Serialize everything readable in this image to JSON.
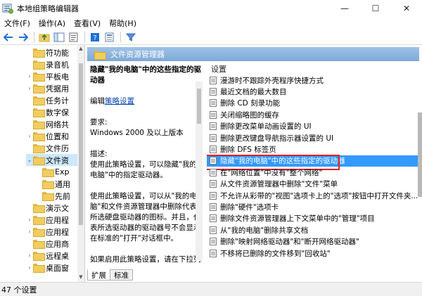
{
  "window": {
    "title": "本地组策略编辑器",
    "minimize": "—",
    "maximize": "☐",
    "close": "✕"
  },
  "menu": [
    "文件(F)",
    "操作(A)",
    "查看(V)",
    "帮助(H)"
  ],
  "toolbar": {
    "icons": [
      "back-icon",
      "forward-icon",
      "up-folder-icon",
      "show-hide-tree-icon",
      "export-list-icon",
      "help-icon",
      "properties-icon",
      "filter-icon"
    ]
  },
  "tree": {
    "items": [
      {
        "label": "符功能",
        "expander": ""
      },
      {
        "label": "录音机",
        "expander": ""
      },
      {
        "label": "平板电",
        "expander": "›"
      },
      {
        "label": "凭据用",
        "expander": "›"
      },
      {
        "label": "任务计",
        "expander": ""
      },
      {
        "label": "数字保",
        "expander": ""
      },
      {
        "label": "网络共",
        "expander": ""
      },
      {
        "label": "位置和",
        "expander": "›"
      },
      {
        "label": "文件历",
        "expander": ""
      },
      {
        "label": "文件资",
        "expander": "⌄"
      },
      {
        "label": "Exp",
        "expander": ""
      },
      {
        "label": "通用",
        "expander": ""
      },
      {
        "label": "先前",
        "expander": ""
      },
      {
        "label": "演示文",
        "expander": ""
      },
      {
        "label": "应用程",
        "expander": "›"
      },
      {
        "label": "应用程",
        "expander": "›"
      },
      {
        "label": "应用商",
        "expander": ""
      },
      {
        "label": "远程桌",
        "expander": "›"
      },
      {
        "label": "桌面窗",
        "expander": "›"
      }
    ]
  },
  "pane_header": "文件资源管理器",
  "description": {
    "title": "隐藏\"我的电脑\"中的这些指定的驱动器",
    "edit_prefix": "编辑",
    "edit_link": "策略设置",
    "requirements_label": "要求:",
    "requirements_value": "Windows 2000 及以上版本",
    "desc_label": "描述:",
    "paragraph1": "使用此策略设置，可以隐藏\"我的电脑\"中的指定驱动器。",
    "paragraph2": "使用此策略设置，可以从\"我的电脑\"和文件资源管理器中删除代表所选硬盘驱动器的图标。并且，代表所选驱动器的驱动器号不会显示在标准的\"打开\"对话框中。",
    "paragraph3": "如果启用此策略设置，请在下拉列表中选择一个驱动器或多个驱动器的组合。"
  },
  "list": {
    "header": "设置",
    "selected_index": 7,
    "rows": [
      "漫游时不跟踪外壳程序快捷方式",
      "最近文档的最大数目",
      "删除 CD 刻录功能",
      "关闭缩略图的缓存",
      "删除更改菜单动画设置的 UI",
      "删除更改键盘导航指示器设置的 UI",
      "删除 DFS 标签页",
      "隐藏\"我的电脑\"中的这些指定的驱动器",
      "在\"网络位置\"中没有\"整个网络\"",
      "从文件资源管理器中删除\"文件\"菜单",
      "不允许从彩带的\"视图\"选项卡上的\"选项\"按钮中打开文件夹...",
      "删除\"硬件\"选项卡",
      "删除文件资源管理器上下文菜单中的\"管理\"项目",
      "从\"我的电脑\"删除共享文档",
      "删除\"映射网络驱动器\"和\"断开网络驱动器\"",
      "不移将已删除的文件移到\"回收站\""
    ]
  },
  "tabs": [
    "扩展",
    "标准"
  ],
  "status": "47 个设置"
}
